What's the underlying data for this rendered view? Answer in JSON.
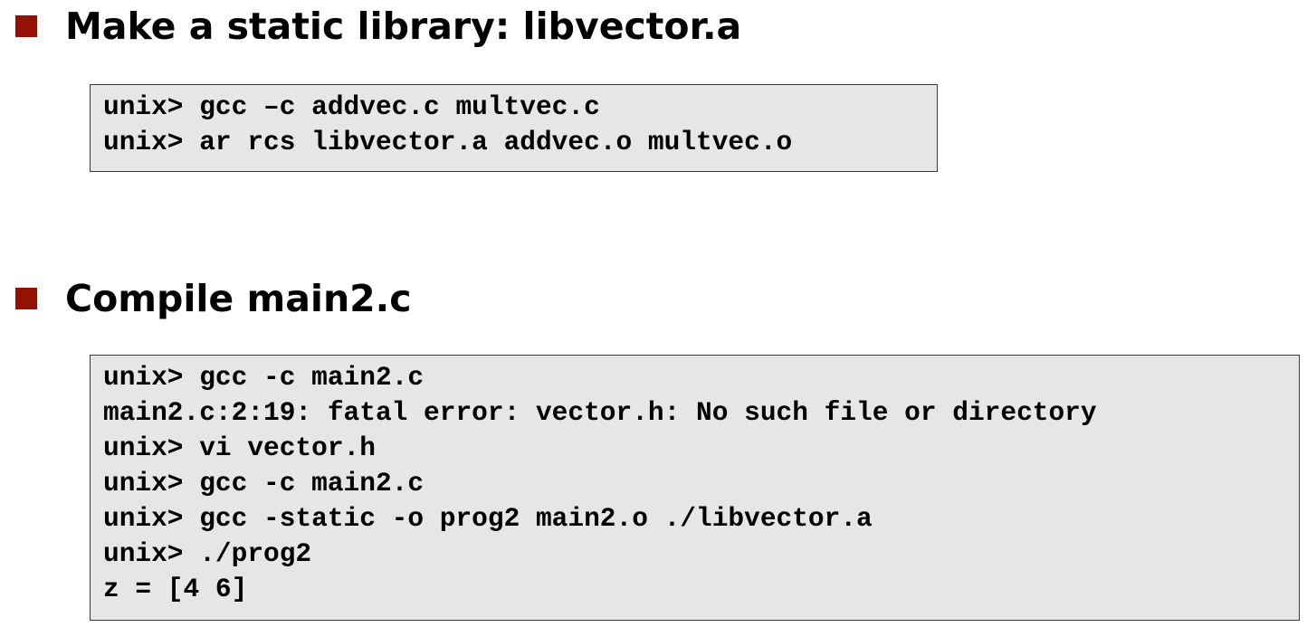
{
  "colors": {
    "bullet": "#941100",
    "code_background": "#e6e6e6",
    "code_border": "#3a3a3a",
    "text": "#000000"
  },
  "sections": [
    {
      "heading": "Make a static library: libvector.a",
      "code": [
        "unix> gcc –c addvec.c multvec.c",
        "unix> ar rcs libvector.a addvec.o multvec.o"
      ]
    },
    {
      "heading": "Compile main2.c",
      "code": [
        "unix> gcc -c main2.c",
        "main2.c:2:19: fatal error: vector.h: No such file or directory",
        "unix> vi vector.h",
        "unix> gcc -c main2.c",
        "unix> gcc -static -o prog2 main2.o ./libvector.a",
        "unix> ./prog2",
        "z = [4 6]"
      ]
    }
  ]
}
